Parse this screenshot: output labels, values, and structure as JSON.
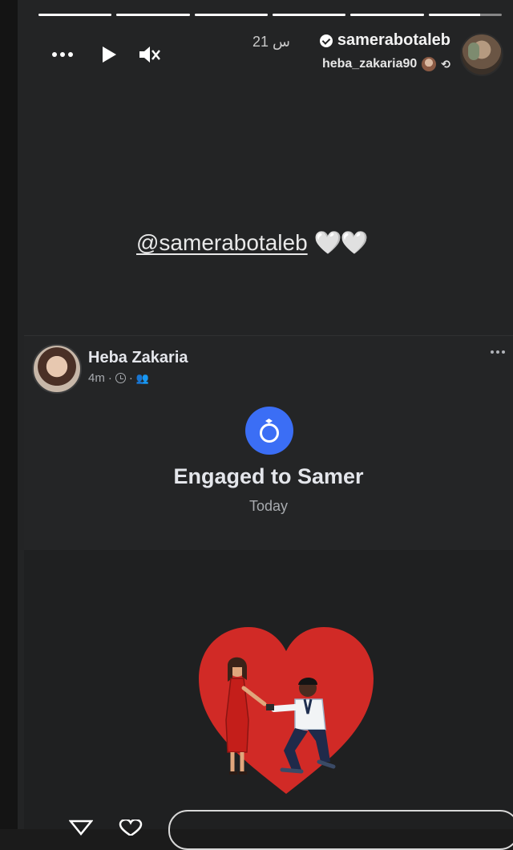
{
  "story": {
    "segments": [
      1,
      1,
      1,
      1,
      1,
      0.7
    ],
    "username": "samerabotaleb",
    "time": "21 س",
    "reshared_from": "heba_zakaria90",
    "mention": "@samerabotaleb",
    "hearts": "🤍🤍",
    "icons": {
      "more": "more-dots-icon",
      "play": "play-icon",
      "mute": "speaker-muted-icon",
      "verified": "verified-badge-icon",
      "repost": "repost-icon"
    }
  },
  "fb_post": {
    "name": "Heba Zakaria",
    "time_ago": "4m",
    "separator": "·",
    "event_title": "Engaged to Samer",
    "event_date": "Today",
    "colors": {
      "badge": "#3b6ef5",
      "heart": "#d12a26"
    }
  }
}
